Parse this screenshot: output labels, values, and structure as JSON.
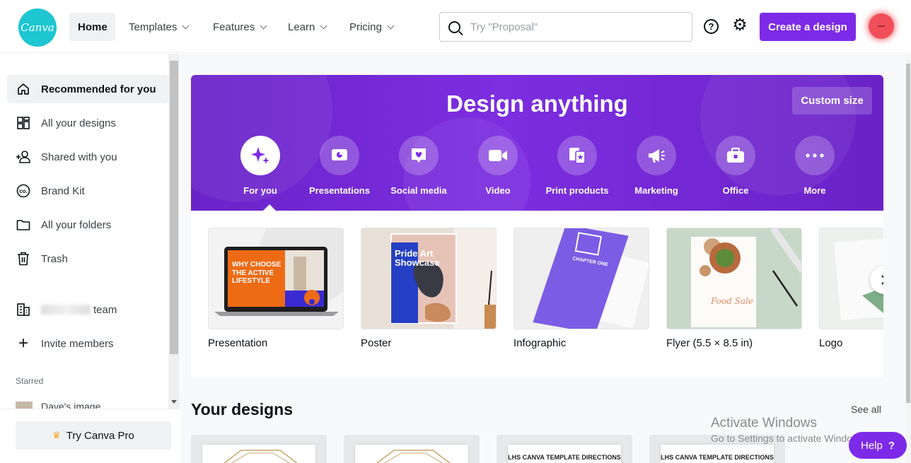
{
  "header": {
    "logo_text": "Canva",
    "nav": [
      {
        "label": "Home",
        "active": true,
        "dropdown": false
      },
      {
        "label": "Templates",
        "dropdown": true
      },
      {
        "label": "Features",
        "dropdown": true
      },
      {
        "label": "Learn",
        "dropdown": true
      },
      {
        "label": "Pricing",
        "dropdown": true
      }
    ],
    "search_placeholder": "Try \"Proposal\"",
    "help_icon_glyph": "?",
    "create_button": "Create a design",
    "accent_color": "#7d2ae8"
  },
  "sidebar": {
    "items": [
      {
        "label": "Recommended for you",
        "icon": "home-icon",
        "active": true
      },
      {
        "label": "All your designs",
        "icon": "grid-icon"
      },
      {
        "label": "Shared with you",
        "icon": "shared-users-icon"
      },
      {
        "label": "Brand Kit",
        "icon": "brand-kit-icon"
      },
      {
        "label": "All your folders",
        "icon": "folder-icon"
      },
      {
        "label": "Trash",
        "icon": "trash-icon"
      },
      {
        "label": "team",
        "icon": "team-building-icon"
      },
      {
        "label": "Invite members",
        "icon": "plus-icon"
      }
    ],
    "brand_kit_glyph": "co.",
    "starred_label": "Starred",
    "starred_items": [
      {
        "label": "Dave's image"
      }
    ],
    "try_pro": "Try Canva Pro"
  },
  "hero": {
    "title": "Design anything",
    "custom_size": "Custom size",
    "categories": [
      {
        "label": "For you",
        "icon": "sparkle-icon",
        "active": true
      },
      {
        "label": "Presentations",
        "icon": "presentation-icon"
      },
      {
        "label": "Social media",
        "icon": "heart-chat-icon"
      },
      {
        "label": "Video",
        "icon": "video-camera-icon"
      },
      {
        "label": "Print products",
        "icon": "print-products-icon"
      },
      {
        "label": "Marketing",
        "icon": "megaphone-icon"
      },
      {
        "label": "Office",
        "icon": "briefcase-icon"
      },
      {
        "label": "More",
        "icon": "more-dots-icon"
      }
    ]
  },
  "templates": [
    {
      "label": "Presentation",
      "preview_text": "WHY CHOOSE THE ACTIVE LIFESTYLE"
    },
    {
      "label": "Poster",
      "preview_text": "Pride Art Showcase"
    },
    {
      "label": "Infographic",
      "preview_text": "CHAPTER ONE"
    },
    {
      "label": "Flyer (5.5 × 8.5 in)",
      "preview_text": "Food Sale"
    },
    {
      "label": "Logo"
    }
  ],
  "your_designs": {
    "title": "Your designs",
    "see_all": "See all",
    "cards": [
      {
        "text": ""
      },
      {
        "text": ""
      },
      {
        "text": "LHS CANVA TEMPLATE DIRECTIONS"
      },
      {
        "text": "LHS CANVA TEMPLATE DIRECTIONS"
      }
    ]
  },
  "overlay": {
    "activate_title": "Activate Windows",
    "activate_sub": "Go to Settings to activate Windows.",
    "help_button": "Help",
    "help_glyph": "?"
  }
}
